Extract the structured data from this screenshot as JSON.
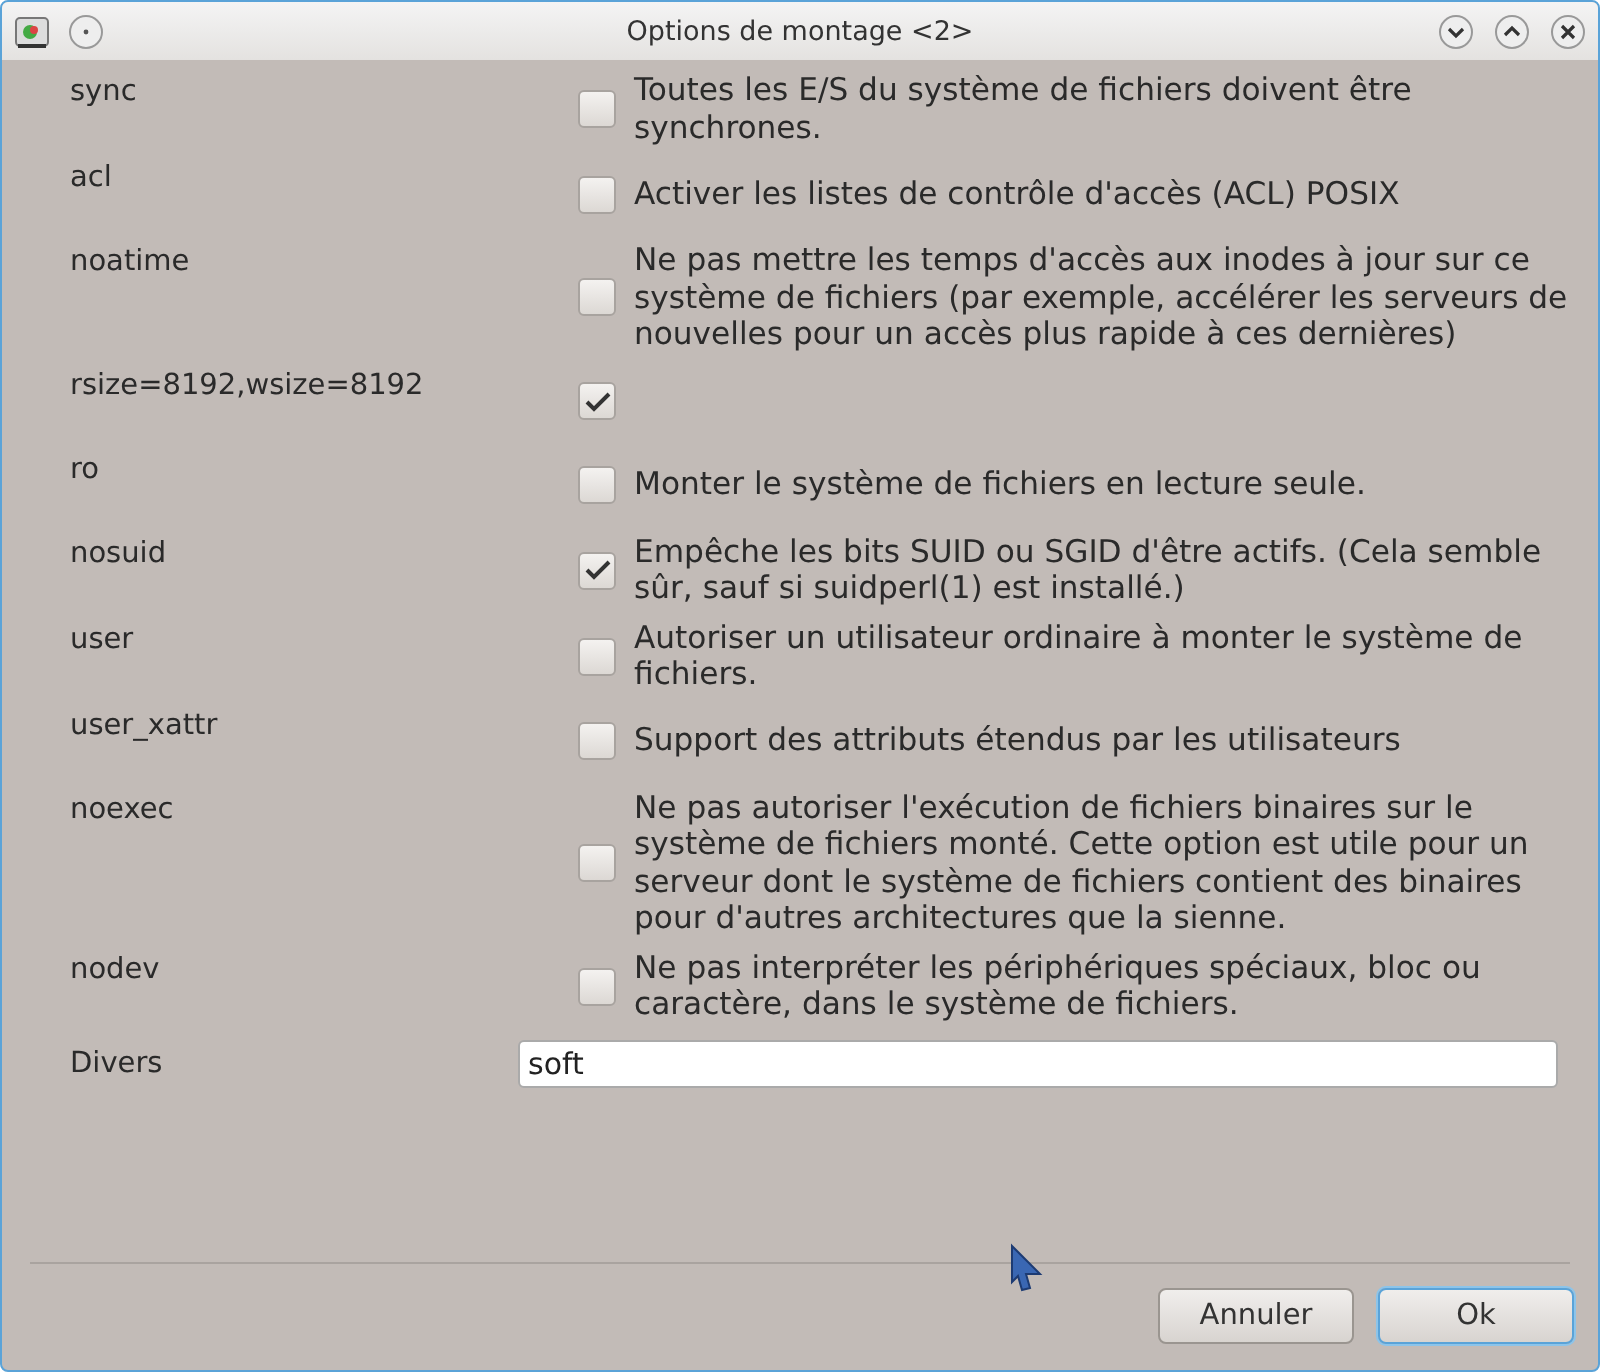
{
  "window": {
    "title": "Options de montage <2>"
  },
  "options": [
    {
      "name": "sync",
      "checked": false,
      "description": "Toutes les E/S du système de fichiers doivent être synchrones."
    },
    {
      "name": "acl",
      "checked": false,
      "description": "Activer les listes de contrôle d'accès (ACL) POSIX"
    },
    {
      "name": "noatime",
      "checked": false,
      "description": "Ne pas mettre les temps d'accès aux inodes à jour sur ce système de fichiers (par exemple, accélérer les serveurs de nouvelles pour un accès plus rapide à ces dernières)"
    },
    {
      "name": "rsize=8192,wsize=8192",
      "checked": true
    },
    {
      "name": "ro",
      "checked": false,
      "description": "Monter le système de fichiers en lecture seule."
    },
    {
      "name": "nosuid",
      "checked": true,
      "description": "Empêche les bits SUID ou SGID d'être actifs. (Cela semble sûr, sauf si suidperl(1) est installé.)"
    },
    {
      "name": "user",
      "checked": false,
      "description": "Autoriser un utilisateur ordinaire à monter le système de fichiers."
    },
    {
      "name": "user_xattr",
      "checked": false,
      "description": "Support des attributs étendus par les utilisateurs"
    },
    {
      "name": "noexec",
      "checked": false,
      "description": "Ne pas autoriser l'exécution de fichiers binaires sur le système de fichiers monté. Cette option est utile pour un serveur dont le système de fichiers contient des binaires pour d'autres architectures que la sienne."
    },
    {
      "name": "nodev",
      "checked": false,
      "description": "Ne pas interpréter les périphériques spéciaux, bloc ou caractère, dans le système de fichiers."
    }
  ],
  "misc": {
    "label": "Divers",
    "value": "soft"
  },
  "buttons": [
    {
      "label": "Annuler",
      "default": false
    },
    {
      "label": "Ok",
      "default": true
    }
  ]
}
